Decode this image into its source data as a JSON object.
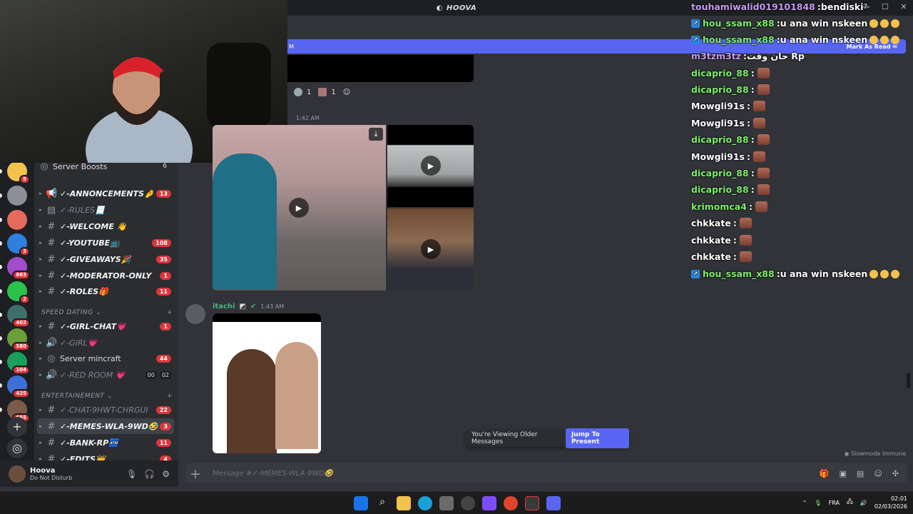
{
  "window": {
    "title": "HOOVA",
    "title_icon": "moon-icon"
  },
  "servers": [
    {
      "badge": "5"
    },
    {
      "badge": ""
    },
    {
      "badge": ""
    },
    {
      "badge": "3"
    },
    {
      "badge": "863"
    },
    {
      "badge": "2"
    },
    {
      "badge": "402"
    },
    {
      "badge": "580"
    },
    {
      "badge": "104"
    },
    {
      "badge": "425"
    },
    {
      "badge": "655"
    }
  ],
  "sidebar": {
    "boosts": {
      "label": "Server Boosts",
      "count": "6"
    },
    "channels": [
      {
        "name": "✓-ANNONCEMENTS🤌",
        "count": "13"
      },
      {
        "name": "✓-RULES📃",
        "count": ""
      },
      {
        "name": "✓-WELCOME 👋",
        "count": ""
      },
      {
        "name": "✓-YOUTUBE📺",
        "count": "108"
      },
      {
        "name": "✓-GIVEAWAYS🎉",
        "count": "35"
      },
      {
        "name": "✓-MODERATOR-ONLY",
        "count": "1"
      },
      {
        "name": "✓-ROLES🎁",
        "count": "11"
      }
    ],
    "cat1": "SPEED DATING",
    "channels2": [
      {
        "name": "✓-GIRL-CHAT💗",
        "count": "1"
      },
      {
        "name": "✓-GIRL💗",
        "count": ""
      },
      {
        "name": "Server mincraft",
        "count": "44"
      },
      {
        "name": "✓-RED ROOM 💗",
        "vc1": "00",
        "vc2": "02"
      }
    ],
    "cat2": "ENTERTAINEMENT",
    "channels3": [
      {
        "name": "✓-CHAT-9HWT-CHRGUI",
        "count": "22"
      },
      {
        "name": "✓-MEMES-WLA-9WD🤣",
        "count": "3"
      },
      {
        "name": "✓-BANK-RP🏧",
        "count": "11"
      },
      {
        "name": "✓-EDITS👑",
        "count": "4"
      }
    ]
  },
  "user": {
    "name": "Hoova",
    "status": "Do Not Disturb"
  },
  "chat": {
    "banner_left": "M",
    "banner_right": "Mark As Read",
    "reactions": [
      {
        "count": "1"
      },
      {
        "count": "1"
      }
    ],
    "time1": "1:42 AM",
    "msg2": {
      "user": "itachi",
      "time": "1:43 AM"
    },
    "older_text": "You're Viewing Older Messages",
    "jump": "Jump To Present",
    "slowmode": "Slowmode Immune",
    "placeholder": "Message #✓-MEMES-WLA-9WD🤣"
  },
  "overlay": [
    {
      "user": "touhamiwalid019101848",
      "text": "bendiski",
      "color": "#c69cf0",
      "badge": false,
      "emotes": 0,
      "smiles": 0
    },
    {
      "user": "hou_ssam_x88",
      "text": "u ana win nskeen",
      "color": "#7cf06a",
      "badge": true,
      "emotes": 0,
      "smiles": 3
    },
    {
      "user": "hou_ssam_x88",
      "text": "u ana win nskeen",
      "color": "#7cf06a",
      "badge": true,
      "emotes": 0,
      "smiles": 3
    },
    {
      "user": "m3tzm3tz",
      "text": "حان وقت Rp",
      "color": "#c69cf0",
      "badge": false,
      "emotes": 0,
      "smiles": 0
    },
    {
      "user": "dicaprio_88",
      "text": "",
      "color": "#7cf06a",
      "badge": false,
      "emotes": 1,
      "smiles": 0
    },
    {
      "user": "dicaprio_88",
      "text": "",
      "color": "#7cf06a",
      "badge": false,
      "emotes": 1,
      "smiles": 0
    },
    {
      "user": "Mowgli91s",
      "text": "",
      "color": "#ffffff",
      "badge": false,
      "emotes": 1,
      "smiles": 0
    },
    {
      "user": "Mowgli91s",
      "text": "",
      "color": "#ffffff",
      "badge": false,
      "emotes": 1,
      "smiles": 0
    },
    {
      "user": "dicaprio_88",
      "text": "",
      "color": "#7cf06a",
      "badge": false,
      "emotes": 1,
      "smiles": 0
    },
    {
      "user": "Mowgli91s",
      "text": "",
      "color": "#ffffff",
      "badge": false,
      "emotes": 1,
      "smiles": 0
    },
    {
      "user": "dicaprio_88",
      "text": "",
      "color": "#7cf06a",
      "badge": false,
      "emotes": 1,
      "smiles": 0
    },
    {
      "user": "dicaprio_88",
      "text": "",
      "color": "#7cf06a",
      "badge": false,
      "emotes": 1,
      "smiles": 0
    },
    {
      "user": "krimomca4",
      "text": "",
      "color": "#7cf06a",
      "badge": false,
      "emotes": 1,
      "smiles": 0
    },
    {
      "user": "chkkate",
      "text": "",
      "color": "#ffffff",
      "badge": false,
      "emotes": 1,
      "smiles": 0
    },
    {
      "user": "chkkate",
      "text": "",
      "color": "#ffffff",
      "badge": false,
      "emotes": 1,
      "smiles": 0
    },
    {
      "user": "chkkate",
      "text": "",
      "color": "#ffffff",
      "badge": false,
      "emotes": 1,
      "smiles": 0
    },
    {
      "user": "hou_ssam_x88",
      "text": "u ana win nskeen",
      "color": "#7cf06a",
      "badge": true,
      "emotes": 0,
      "smiles": 3
    }
  ],
  "taskbar": {
    "lang": "FRA",
    "time": "02:01",
    "date": "02/03/2026"
  },
  "colors": {
    "accent": "#5865f2",
    "danger": "#da373c",
    "bg": "#313338"
  }
}
